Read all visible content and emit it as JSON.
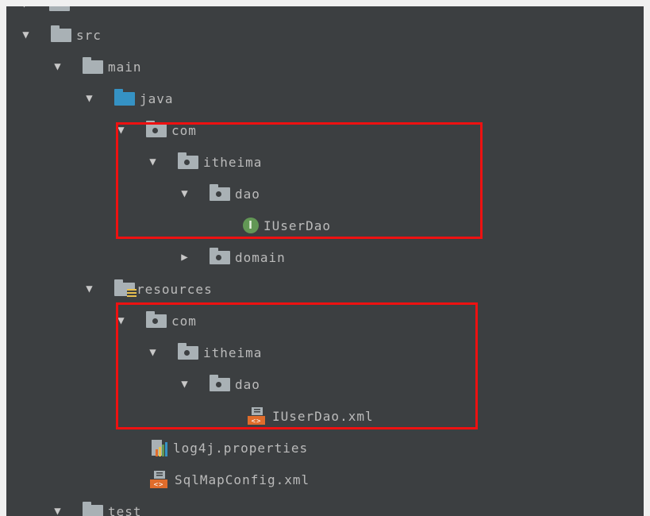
{
  "tree": {
    "items": [
      {
        "name": "tree-item-src",
        "label": "src",
        "expanded": true,
        "icon": "folder-icon"
      },
      {
        "name": "tree-item-main",
        "label": "main",
        "expanded": true,
        "icon": "folder-icon"
      },
      {
        "name": "tree-item-java",
        "label": "java",
        "expanded": true,
        "icon": "source-root-folder-icon"
      },
      {
        "name": "tree-item-com-java",
        "label": "com",
        "expanded": true,
        "icon": "package-icon"
      },
      {
        "name": "tree-item-itheima-java",
        "label": "itheima",
        "expanded": true,
        "icon": "package-icon"
      },
      {
        "name": "tree-item-dao-java",
        "label": "dao",
        "expanded": true,
        "icon": "package-icon"
      },
      {
        "name": "tree-item-iuserdao",
        "label": "IUserDao",
        "icon": "interface-icon",
        "icon_letter": "I"
      },
      {
        "name": "tree-item-domain",
        "label": "domain",
        "expanded": false,
        "icon": "package-icon"
      },
      {
        "name": "tree-item-resources",
        "label": "resources",
        "expanded": true,
        "icon": "resources-folder-icon"
      },
      {
        "name": "tree-item-com-res",
        "label": "com",
        "expanded": true,
        "icon": "package-icon"
      },
      {
        "name": "tree-item-itheima-res",
        "label": "itheima",
        "expanded": true,
        "icon": "package-icon"
      },
      {
        "name": "tree-item-dao-res",
        "label": "dao",
        "expanded": true,
        "icon": "package-icon"
      },
      {
        "name": "tree-item-iuserdao-xml",
        "label": "IUserDao.xml",
        "icon": "xml-file-icon"
      },
      {
        "name": "tree-item-log4j",
        "label": "log4j.properties",
        "icon": "properties-file-icon"
      },
      {
        "name": "tree-item-sqlmapconfig",
        "label": "SqlMapConfig.xml",
        "icon": "xml-file-icon"
      },
      {
        "name": "tree-item-test",
        "label": "test",
        "expanded": true,
        "icon": "folder-icon"
      }
    ]
  },
  "glyphs": {
    "expanded": "▼",
    "collapsed": "▶"
  },
  "colors": {
    "background": "#3c3f41",
    "text": "#bbbbbb",
    "highlight": "#ee1111",
    "interface": "#629755",
    "source_root": "#3592c4"
  }
}
